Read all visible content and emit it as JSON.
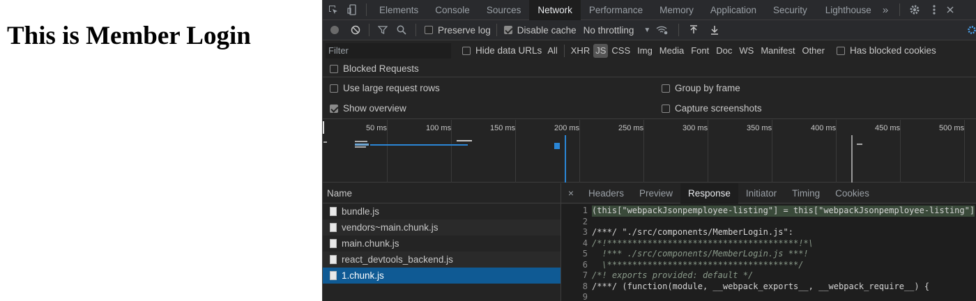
{
  "page": {
    "heading": "This is Member Login"
  },
  "devtools": {
    "tabs": [
      "Elements",
      "Console",
      "Sources",
      "Network",
      "Performance",
      "Memory",
      "Application",
      "Security",
      "Lighthouse"
    ],
    "active_tab": "Network",
    "more_tabs": "»",
    "toolbar": {
      "preserve_log": "Preserve log",
      "disable_cache": "Disable cache",
      "throttling": "No throttling"
    },
    "filter": {
      "placeholder": "Filter",
      "hide_data_urls": "Hide data URLs",
      "types": [
        "All",
        "XHR",
        "JS",
        "CSS",
        "Img",
        "Media",
        "Font",
        "Doc",
        "WS",
        "Manifest",
        "Other"
      ],
      "selected_type": "JS",
      "has_blocked_cookies": "Has blocked cookies",
      "blocked_requests": "Blocked Requests"
    },
    "settings": {
      "large_rows": "Use large request rows",
      "show_overview": "Show overview",
      "group_by_frame": "Group by frame",
      "capture_screenshots": "Capture screenshots"
    },
    "timeline_ticks": [
      "50 ms",
      "100 ms",
      "150 ms",
      "200 ms",
      "250 ms",
      "300 ms",
      "350 ms",
      "400 ms",
      "450 ms",
      "500 ms"
    ],
    "name_header": "Name",
    "files": [
      "bundle.js",
      "vendors~main.chunk.js",
      "main.chunk.js",
      "react_devtools_backend.js",
      "1.chunk.js"
    ],
    "selected_file": "1.chunk.js",
    "detail_tabs": [
      "Headers",
      "Preview",
      "Response",
      "Initiator",
      "Timing",
      "Cookies"
    ],
    "active_detail_tab": "Response",
    "code_lines": [
      "(this[\"webpackJsonpemployee-listing\"] = this[\"webpackJsonpemployee-listing\"]",
      "",
      "/***/ \"./src/components/MemberLogin.js\":",
      "/*!**************************************!*\\",
      "  !*** ./src/components/MemberLogin.js ***!",
      "  \\**************************************/",
      "/*! exports provided: default */",
      "/***/ (function(module, __webpack_exports__, __webpack_require__) {",
      ""
    ]
  }
}
